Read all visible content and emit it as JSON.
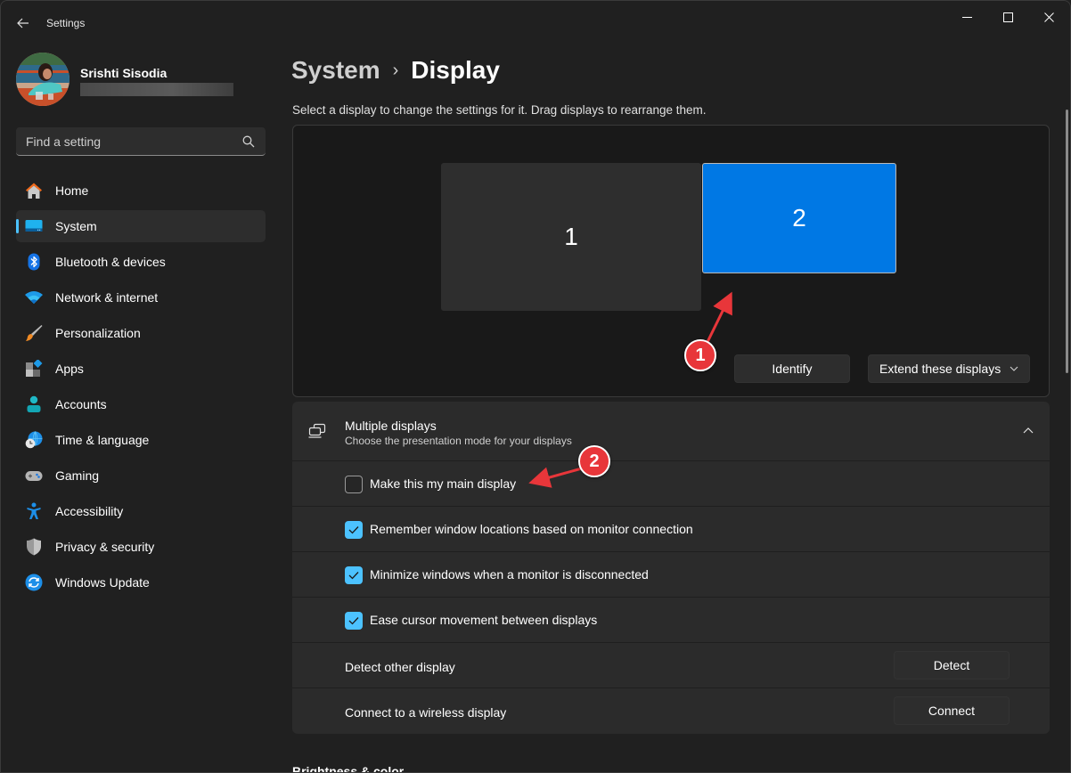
{
  "window": {
    "app_title": "Settings",
    "controls": {
      "minimize": "minimize",
      "maximize": "maximize",
      "close": "close"
    }
  },
  "profile": {
    "name": "Srishti Sisodia",
    "email_redacted": true
  },
  "search": {
    "placeholder": "Find a setting",
    "value": ""
  },
  "sidebar": {
    "items": [
      {
        "label": "Home",
        "icon": "home-icon",
        "active": false
      },
      {
        "label": "System",
        "icon": "system-icon",
        "active": true
      },
      {
        "label": "Bluetooth & devices",
        "icon": "bluetooth-icon",
        "active": false
      },
      {
        "label": "Network & internet",
        "icon": "wifi-icon",
        "active": false
      },
      {
        "label": "Personalization",
        "icon": "brush-icon",
        "active": false
      },
      {
        "label": "Apps",
        "icon": "apps-icon",
        "active": false
      },
      {
        "label": "Accounts",
        "icon": "account-icon",
        "active": false
      },
      {
        "label": "Time & language",
        "icon": "globe-clock-icon",
        "active": false
      },
      {
        "label": "Gaming",
        "icon": "gamepad-icon",
        "active": false
      },
      {
        "label": "Accessibility",
        "icon": "accessibility-icon",
        "active": false
      },
      {
        "label": "Privacy & security",
        "icon": "shield-icon",
        "active": false
      },
      {
        "label": "Windows Update",
        "icon": "update-icon",
        "active": false
      }
    ],
    "accent_color": "#4cc2ff"
  },
  "breadcrumb": {
    "parent": "System",
    "separator": "›",
    "current": "Display"
  },
  "arrangement": {
    "hint": "Select a display to change the settings for it. Drag displays to rearrange them.",
    "monitors": [
      {
        "label": "1",
        "selected": false
      },
      {
        "label": "2",
        "selected": true
      }
    ],
    "selected_color": "#0078e4",
    "identify_label": "Identify",
    "mode_select": {
      "value": "Extend these displays"
    }
  },
  "multiple_displays": {
    "title": "Multiple displays",
    "subtitle": "Choose the presentation mode for your displays",
    "expanded": true,
    "options": [
      {
        "label": "Make this my main display",
        "checked": false
      },
      {
        "label": "Remember window locations based on monitor connection",
        "checked": true
      },
      {
        "label": "Minimize windows when a monitor is disconnected",
        "checked": true
      },
      {
        "label": "Ease cursor movement between displays",
        "checked": true
      }
    ],
    "actions": [
      {
        "label": "Detect other display",
        "button": "Detect"
      },
      {
        "label": "Connect to a wireless display",
        "button": "Connect"
      }
    ]
  },
  "next_section": {
    "heading": "Brightness & color"
  },
  "annotations": [
    {
      "number": "1",
      "color": "#e8363a"
    },
    {
      "number": "2",
      "color": "#e8363a"
    }
  ]
}
